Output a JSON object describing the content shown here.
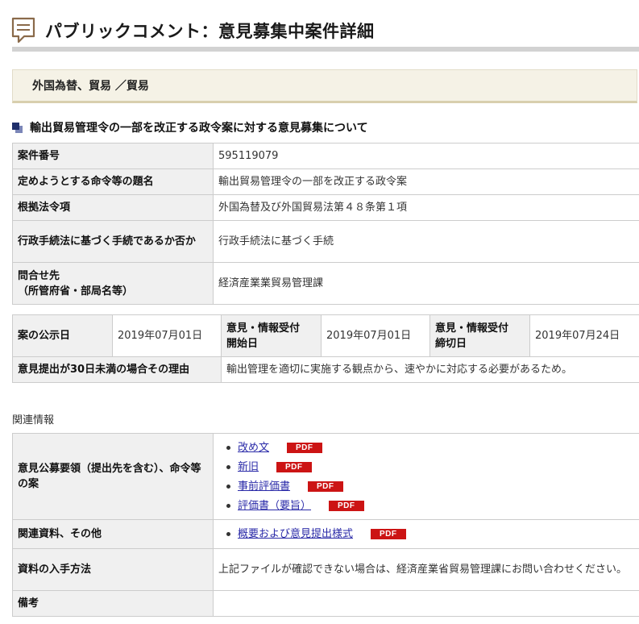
{
  "page_title": "パブリックコメント：意見募集中案件詳細",
  "category": "外国為替、貿易 ／貿易",
  "heading": "輸出貿易管理令の一部を改正する政令案に対する意見募集について",
  "details": [
    {
      "label": "案件番号",
      "value": "595119079"
    },
    {
      "label": "定めようとする命令等の題名",
      "value": "輸出貿易管理令の一部を改正する政令案"
    },
    {
      "label": "根拠法令項",
      "value": "外国為替及び外国貿易法第４８条第１項"
    },
    {
      "label": "行政手続法に基づく手続であるか否か",
      "value": "行政手続法に基づく手続"
    },
    {
      "label_line1": "問合せ先",
      "label_line2": "（所管府省・部局名等）",
      "value": "経済産業業貿易管理課"
    }
  ],
  "dates": {
    "publish_label": "案の公示日",
    "publish_value": "2019年07月01日",
    "start_label_line1": "意見・情報受付",
    "start_label_line2": "開始日",
    "start_value": "2019年07月01日",
    "end_label_line1": "意見・情報受付",
    "end_label_line2": "締切日",
    "end_value": "2019年07月24日",
    "reason_label": "意見提出が30日未満の場合その理由",
    "reason_value": "輸出管理を適切に実施する観点から、速やかに対応する必要があるため。"
  },
  "related": {
    "section_label": "関連情報",
    "guideline_label": "意見公募要領（提出先を含む）、命令等の案",
    "guideline_links": [
      "改め文",
      "新旧",
      "事前評価書",
      "評価書（要旨）"
    ],
    "pdf_badge": "PDF",
    "materials_label": "関連資料、その他",
    "materials_links": [
      "概要および意見提出様式"
    ],
    "obtain_label": "資料の入手方法",
    "obtain_value": "上記ファイルが確認できない場合は、経済産業省貿易管理課にお問い合わせください。",
    "notes_label": "備考",
    "notes_value": ""
  },
  "icons": {
    "title": "comment-icon",
    "heading": "square-bullet-icon"
  },
  "colors": {
    "pdf_badge": "#cc1414",
    "link": "#2a2aa8",
    "category_bg": "#f5f2e6",
    "heading_bullet": "#1f2f6b"
  }
}
